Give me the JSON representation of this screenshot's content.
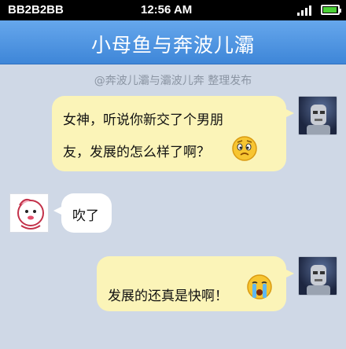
{
  "status_bar": {
    "carrier": "BB2B2BB",
    "time": "12:56 AM",
    "signal_icon": "signal-bars-icon",
    "battery_icon": "battery-icon",
    "battery_color": "#4cd137"
  },
  "header": {
    "title": "小母鱼与奔波儿灞",
    "bar_color": "#4f97e4"
  },
  "credit": "@奔波儿灞与灞波儿奔 整理发布",
  "messages": [
    {
      "side": "right",
      "lines": [
        "女神，听说你新交了个男朋",
        "友，发展的怎么样了啊？"
      ],
      "emoji": "puzzled-face-emoji",
      "avatar": "robot-avatar"
    },
    {
      "side": "left",
      "lines": [
        "吹了"
      ],
      "avatar": "cute-character-avatar"
    },
    {
      "side": "right",
      "lines": [
        "发展的还真是快啊！"
      ],
      "emoji": "crying-face-emoji",
      "avatar": "robot-avatar"
    }
  ],
  "colors": {
    "background": "#cfd8e6",
    "outgoing_bubble": "#fbf4b8",
    "incoming_bubble": "#ffffff"
  }
}
